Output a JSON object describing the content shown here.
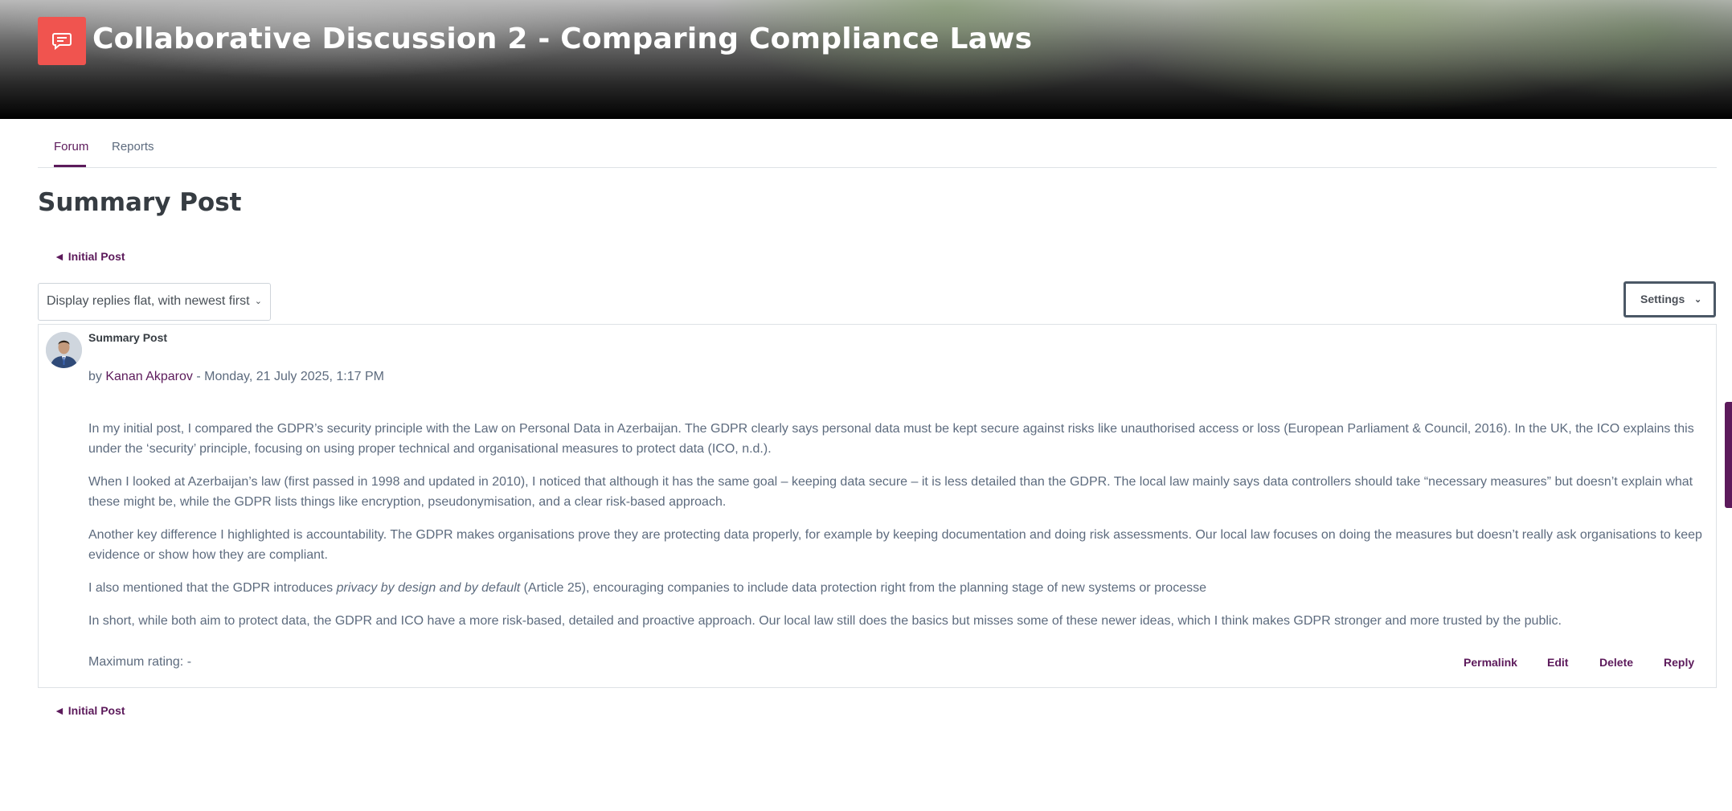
{
  "header": {
    "title": "Collaborative Discussion 2 - Comparing Compliance Laws",
    "icon": "forum-icon",
    "icon_color": "#f0544f"
  },
  "tabs": [
    {
      "label": "Forum",
      "active": true
    },
    {
      "label": "Reports",
      "active": false
    }
  ],
  "page": {
    "title": "Summary Post",
    "prev_link": "◄ Initial Post",
    "display_mode": "Display replies flat, with newest first",
    "settings_label": "Settings"
  },
  "post": {
    "subject": "Summary Post",
    "by": "by",
    "author": "Kanan Akparov",
    "date": " - Monday, 21 July 2025, 1:17 PM",
    "paragraphs": [
      "In my initial post, I compared the GDPR’s security principle with the Law on Personal Data in Azerbaijan. The GDPR clearly says personal data must be kept secure against risks like unauthorised access or loss (European Parliament & Council, 2016). In the UK, the ICO explains this under the ‘security’ principle, focusing on using proper technical and organisational measures to protect data (ICO, n.d.).",
      "When I looked at Azerbaijan’s law (first passed in 1998 and updated in 2010), I noticed that although it has the same goal – keeping data secure – it is less detailed than the GDPR. The local law mainly says data controllers should take “necessary measures” but doesn’t explain what these might be, while the GDPR lists things like encryption, pseudonymisation, and a clear risk-based approach.",
      "Another key difference I highlighted is accountability. The GDPR makes organisations prove they are protecting data properly, for example by keeping documentation and doing risk assessments. Our local law focuses on doing the measures but doesn’t really ask organisations to keep evidence or show how they are compliant."
    ],
    "p4_before": "I also mentioned that the GDPR introduces ",
    "p4_italic": "privacy by design and by default",
    "p4_after": " (Article 25), encouraging companies to include data protection right from the planning stage of new systems or processe",
    "p5": "In short, while both aim to protect data, the GDPR and ICO have a more risk-based, detailed and proactive approach. Our local law still does the basics but misses some of these newer ideas, which I think makes GDPR stronger and more trusted by the public.",
    "rating": "Maximum rating: -",
    "actions": {
      "permalink": "Permalink",
      "edit": "Edit",
      "delete": "Delete",
      "reply": "Reply"
    }
  },
  "colors": {
    "brand": "#5c1a5b",
    "text": "#5d6b7e",
    "heading": "#363c42"
  }
}
